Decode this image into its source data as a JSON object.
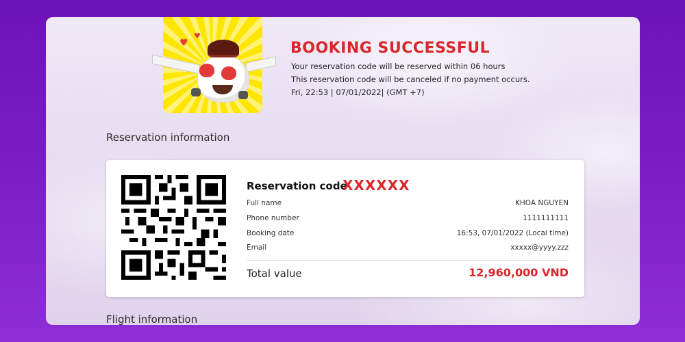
{
  "header": {
    "title": "BOOKING SUCCESSFUL",
    "line1": "Your reservation code will be reserved within 06 hours",
    "line2": "This reservation code will be canceled if no payment occurs.",
    "timestamp": "Fri, 22:53 | 07/01/2022| (GMT +7)"
  },
  "sections": {
    "reservation_title": "Reservation information",
    "flight_title": "Flight information"
  },
  "reservation": {
    "code_label": "Reservation code",
    "code_value": "XXXXXX",
    "rows": [
      {
        "label": "Full name",
        "value": "KHOA NGUYEN"
      },
      {
        "label": "Phone number",
        "value": "1111111111"
      },
      {
        "label": "Booking date",
        "value": "16:53, 07/01/2022 (Local time)"
      },
      {
        "label": "Email",
        "value": "xxxxx@yyyy.zzz"
      }
    ],
    "total_label": "Total value",
    "total_value": "12,960,000 VND"
  },
  "colors": {
    "accent": "#d8262a",
    "background": "#7a1cc4",
    "mascot_bg": "#ffe600"
  },
  "icons": {
    "mascot": "airplane-mascot-icon",
    "qr": "qr-code-icon"
  }
}
